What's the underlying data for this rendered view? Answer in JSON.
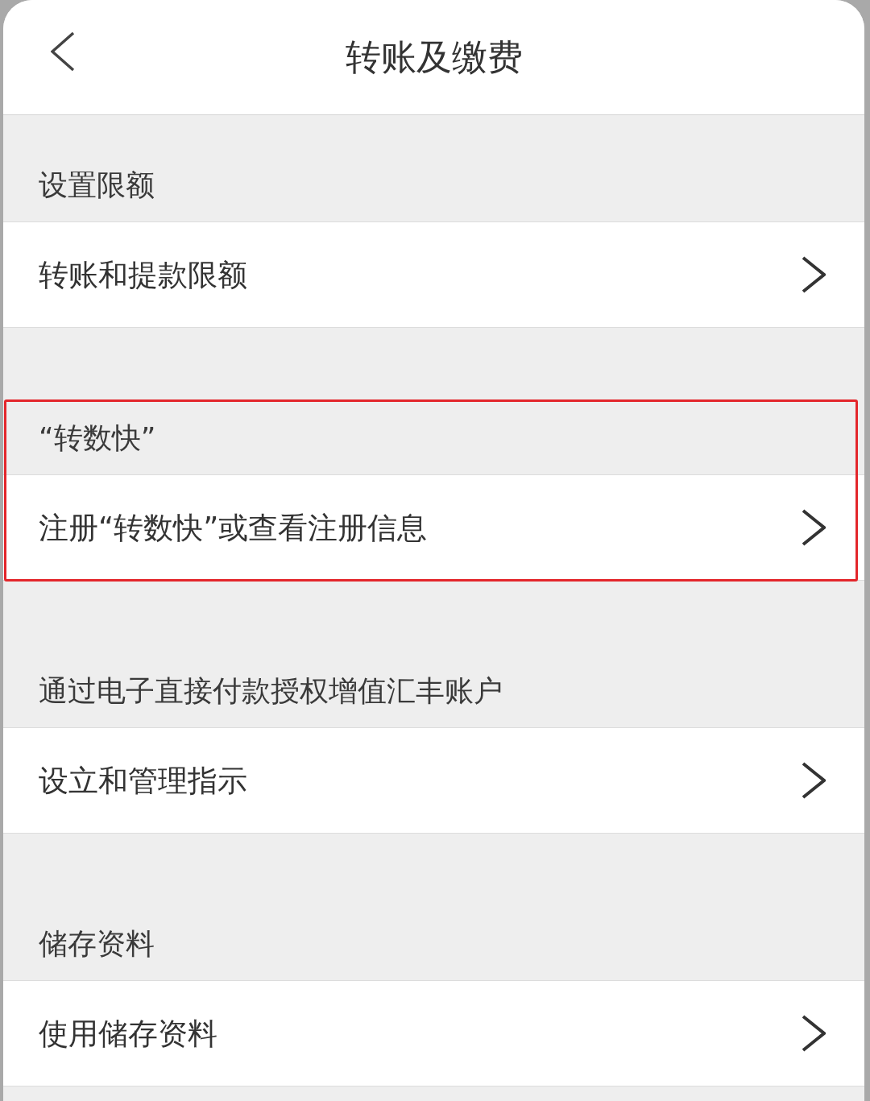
{
  "header": {
    "title": "转账及缴费"
  },
  "sections": [
    {
      "title": "设置限额",
      "highlighted": false,
      "items": [
        {
          "label": "转账和提款限额"
        }
      ]
    },
    {
      "title": "“转数快”",
      "highlighted": true,
      "items": [
        {
          "label": "注册“转数快”或查看注册信息"
        }
      ]
    },
    {
      "title": "通过电子直接付款授权增值汇丰账户",
      "highlighted": false,
      "items": [
        {
          "label": "设立和管理指示"
        }
      ]
    },
    {
      "title": "储存资料",
      "highlighted": false,
      "items": [
        {
          "label": "使用储存资料"
        }
      ]
    }
  ]
}
